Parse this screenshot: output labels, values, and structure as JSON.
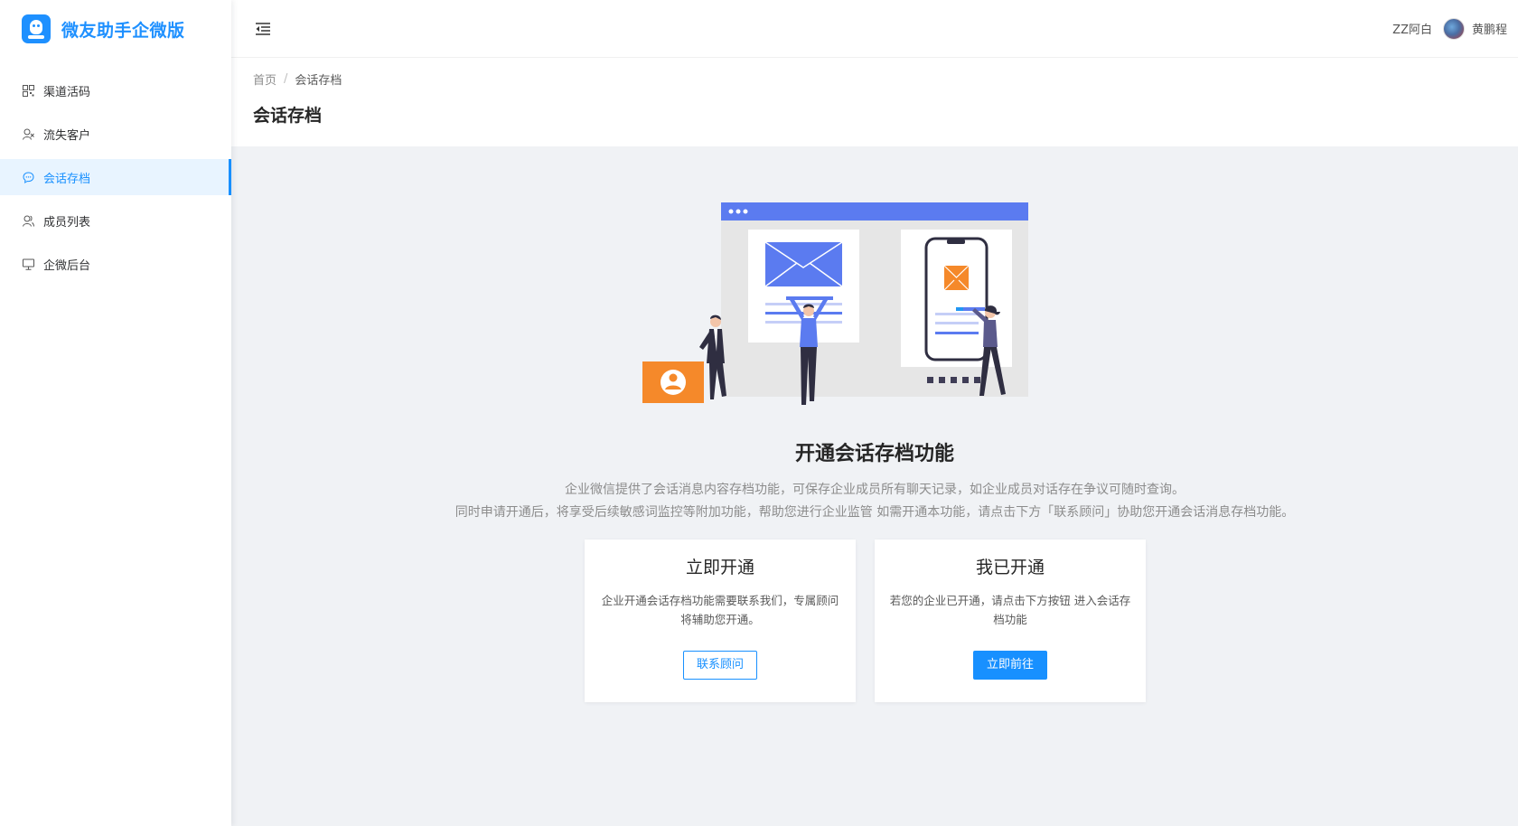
{
  "brand": {
    "title": "微友助手企微版",
    "logo_icon": "robot-logo-icon",
    "color": "#1e90ff"
  },
  "sidebar": {
    "items": [
      {
        "label": "渠道活码",
        "icon": "qrcode-icon",
        "active": false
      },
      {
        "label": "流失客户",
        "icon": "user-lost-icon",
        "active": false
      },
      {
        "label": "会话存档",
        "icon": "chat-icon",
        "active": true
      },
      {
        "label": "成员列表",
        "icon": "users-icon",
        "active": false
      },
      {
        "label": "企微后台",
        "icon": "monitor-icon",
        "active": false
      }
    ]
  },
  "header": {
    "fold_icon": "menu-fold-icon",
    "corp_name": "ZZ阿白",
    "user_name": "黄鹏程"
  },
  "page": {
    "breadcrumb": {
      "home": "首页",
      "separator": "/",
      "current": "会话存档"
    },
    "title": "会话存档"
  },
  "main": {
    "feature_title": "开通会话存档功能",
    "desc_line1": "企业微信提供了会话消息内容存档功能，可保存企业成员所有聊天记录，如企业成员对话存在争议可随时查询。",
    "desc_line2": "同时申请开通后，将享受后续敏感词监控等附加功能，帮助您进行企业监管 如需开通本功能，请点击下方「联系顾问」协助您开通会话消息存档功能。",
    "cards": [
      {
        "title": "立即开通",
        "text": "企业开通会话存档功能需要联系我们，专属顾问将辅助您开通。",
        "button": "联系顾问"
      },
      {
        "title": "我已开通",
        "text": "若您的企业已开通，请点击下方按钮 进入会话存档功能",
        "button": "立即前往"
      }
    ]
  },
  "colors": {
    "accent": "#1890ff",
    "illustration_blue": "#5b7bf0",
    "illustration_orange": "#f5892a",
    "content_bg": "#f0f2f5"
  }
}
